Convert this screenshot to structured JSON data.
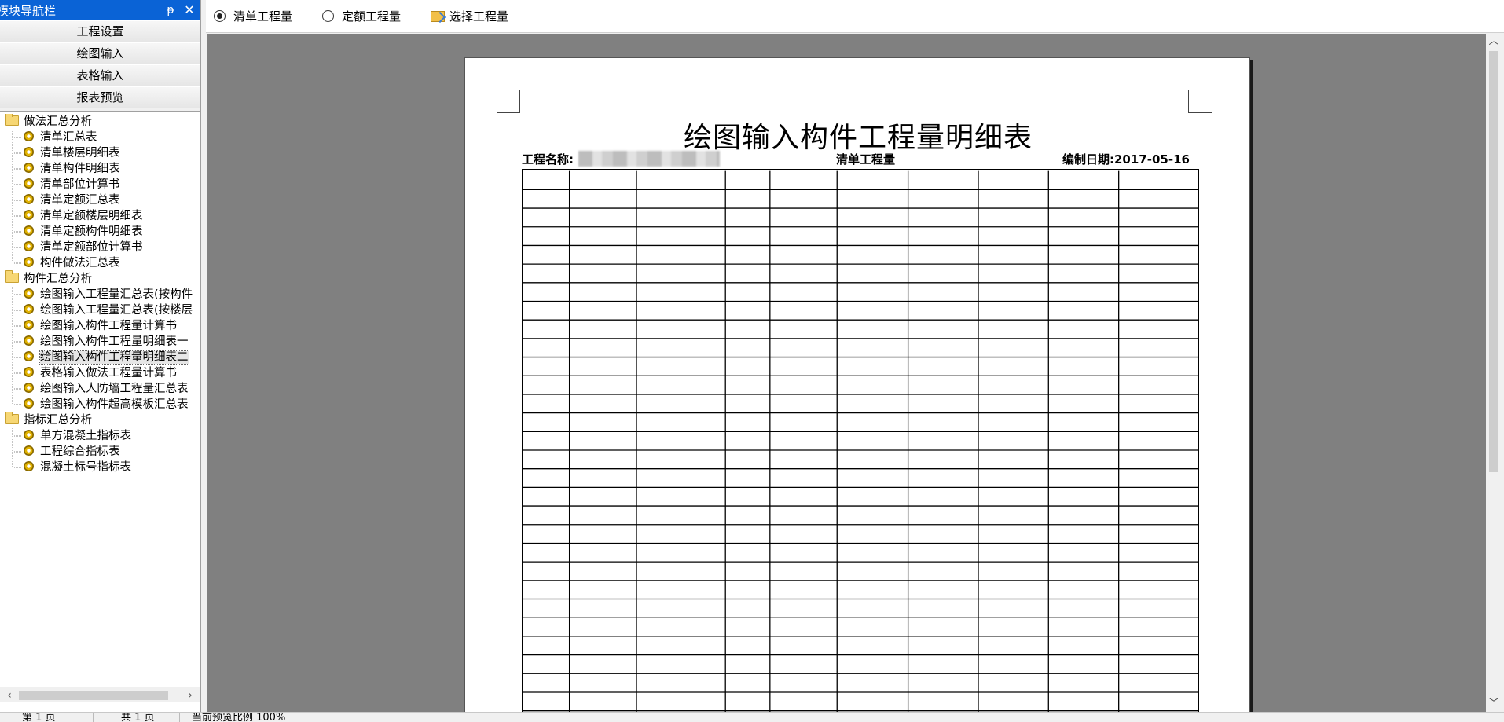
{
  "nav": {
    "title": "模块导航栏",
    "pin_glyph": "ᵽ",
    "close_glyph": "✕",
    "modules": [
      "工程设置",
      "绘图输入",
      "表格输入",
      "报表预览"
    ]
  },
  "tree": [
    {
      "type": "folder",
      "label": "做法汇总分析",
      "depth": 0
    },
    {
      "type": "item",
      "label": "清单汇总表",
      "depth": 1
    },
    {
      "type": "item",
      "label": "清单楼层明细表",
      "depth": 1
    },
    {
      "type": "item",
      "label": "清单构件明细表",
      "depth": 1
    },
    {
      "type": "item",
      "label": "清单部位计算书",
      "depth": 1
    },
    {
      "type": "item",
      "label": "清单定额汇总表",
      "depth": 1
    },
    {
      "type": "item",
      "label": "清单定额楼层明细表",
      "depth": 1
    },
    {
      "type": "item",
      "label": "清单定额构件明细表",
      "depth": 1
    },
    {
      "type": "item",
      "label": "清单定额部位计算书",
      "depth": 1
    },
    {
      "type": "item",
      "label": "构件做法汇总表",
      "depth": 1
    },
    {
      "type": "folder",
      "label": "构件汇总分析",
      "depth": 0
    },
    {
      "type": "item",
      "label": "绘图输入工程量汇总表(按构件",
      "depth": 1
    },
    {
      "type": "item",
      "label": "绘图输入工程量汇总表(按楼层",
      "depth": 1
    },
    {
      "type": "item",
      "label": "绘图输入构件工程量计算书",
      "depth": 1
    },
    {
      "type": "item",
      "label": "绘图输入构件工程量明细表一",
      "depth": 1
    },
    {
      "type": "item",
      "label": "绘图输入构件工程量明细表二",
      "depth": 1,
      "selected": true
    },
    {
      "type": "item",
      "label": "表格输入做法工程量计算书",
      "depth": 1
    },
    {
      "type": "item",
      "label": "绘图输入人防墙工程量汇总表",
      "depth": 1
    },
    {
      "type": "item",
      "label": "绘图输入构件超高模板汇总表",
      "depth": 1
    },
    {
      "type": "folder",
      "label": "指标汇总分析",
      "depth": 0
    },
    {
      "type": "item",
      "label": "单方混凝土指标表",
      "depth": 1
    },
    {
      "type": "item",
      "label": "工程综合指标表",
      "depth": 1
    },
    {
      "type": "item",
      "label": "混凝土标号指标表",
      "depth": 1
    }
  ],
  "toolbar": {
    "radio_bill": "清单工程量",
    "radio_quota": "定额工程量",
    "select_quantity": "选择工程量",
    "selected": "radio_bill"
  },
  "report": {
    "title": "绘图输入构件工程量明细表",
    "project_label": "工程名称:",
    "project_name_blurred": true,
    "quantity_type": "清单工程量",
    "date_label": "编制日期:",
    "date": "2017-05-16",
    "column_count": 10,
    "visible_rows": 29
  },
  "statusbar": {
    "page_current": "第 1 页",
    "page_total": "共 1 页",
    "zoom": "当前预览比例 100%"
  },
  "colors": {
    "titlebar": "#0a63d6",
    "preview_bg": "#808080",
    "page_bg": "#ffffff"
  }
}
